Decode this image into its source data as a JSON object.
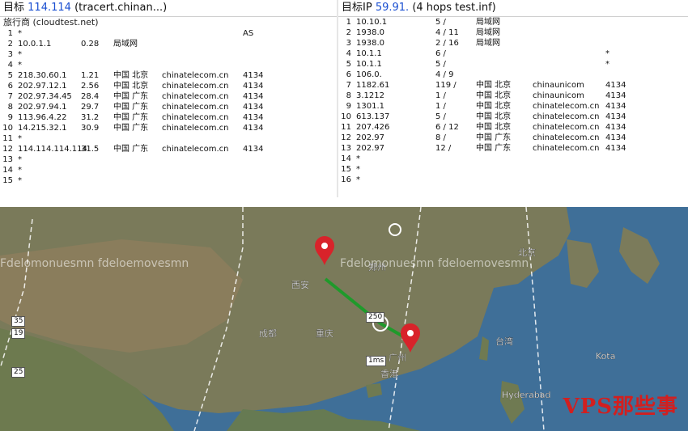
{
  "colors": {
    "accent_blue": "#1a4fd1",
    "pin_red": "#d8232a",
    "route_green": "#1f9a2b",
    "watermark_red": "#d21f1f"
  },
  "left_panel": {
    "title_prefix": "目标",
    "title_highlight": "114.114",
    "title_suffix": "(tracert.chinan...)",
    "subtitle": "旅行商 (cloudtest.net)",
    "hops": [
      {
        "n": "1",
        "ip": "*",
        "ms": "",
        "loc": "",
        "dom": "",
        "as": "AS"
      },
      {
        "n": "2",
        "ip": "10.0.1.1",
        "ms": "0.28",
        "loc": "局域网",
        "dom": "",
        "as": ""
      },
      {
        "n": "3",
        "ip": "*",
        "ms": "",
        "loc": "",
        "dom": "",
        "as": ""
      },
      {
        "n": "4",
        "ip": "*",
        "ms": "",
        "loc": "",
        "dom": "",
        "as": ""
      },
      {
        "n": "5",
        "ip": "218.30.60.1",
        "ms": "1.21",
        "loc": "中国 北京",
        "dom": "chinatelecom.cn",
        "as": "4134"
      },
      {
        "n": "6",
        "ip": "202.97.12.1",
        "ms": "2.56",
        "loc": "中国 北京",
        "dom": "chinatelecom.cn",
        "as": "4134"
      },
      {
        "n": "7",
        "ip": "202.97.34.45",
        "ms": "28.4",
        "loc": "中国 广东",
        "dom": "chinatelecom.cn",
        "as": "4134"
      },
      {
        "n": "8",
        "ip": "202.97.94.1",
        "ms": "29.7",
        "loc": "中国 广东",
        "dom": "chinatelecom.cn",
        "as": "4134"
      },
      {
        "n": "9",
        "ip": "113.96.4.22",
        "ms": "31.2",
        "loc": "中国 广东",
        "dom": "chinatelecom.cn",
        "as": "4134"
      },
      {
        "n": "10",
        "ip": "14.215.32.1",
        "ms": "30.9",
        "loc": "中国 广东",
        "dom": "chinatelecom.cn",
        "as": "4134"
      },
      {
        "n": "11",
        "ip": "*",
        "ms": "",
        "loc": "",
        "dom": "",
        "as": ""
      },
      {
        "n": "12",
        "ip": "114.114.114.114",
        "ms": "31.5",
        "loc": "中国 广东",
        "dom": "chinatelecom.cn",
        "as": "4134"
      },
      {
        "n": "13",
        "ip": "*",
        "ms": "",
        "loc": "",
        "dom": "",
        "as": ""
      },
      {
        "n": "14",
        "ip": "*",
        "ms": "",
        "loc": "",
        "dom": "",
        "as": ""
      },
      {
        "n": "15",
        "ip": "*",
        "ms": "",
        "loc": "",
        "dom": "",
        "as": ""
      }
    ]
  },
  "right_panel": {
    "title_prefix": "目标IP",
    "title_highlight": "59.91.",
    "title_suffix": "(4 hops test.inf)",
    "hops": [
      {
        "n": "1",
        "ip": "10.10.1",
        "ms": "5 /",
        "loc": "局域网",
        "dom": "",
        "as": ""
      },
      {
        "n": "2",
        "ip": "1938.0",
        "ms": "4 / 11",
        "loc": "局域网",
        "dom": "",
        "as": ""
      },
      {
        "n": "3",
        "ip": "1938.0",
        "ms": "2 / 16",
        "loc": "局域网",
        "dom": "",
        "as": ""
      },
      {
        "n": "4",
        "ip": "10.1.1",
        "ms": "6 /",
        "loc": "",
        "dom": "",
        "as": "*"
      },
      {
        "n": "5",
        "ip": "10.1.1",
        "ms": "5 /",
        "loc": "",
        "dom": "",
        "as": "*"
      },
      {
        "n": "6",
        "ip": "106.0.",
        "ms": "4 / 9",
        "loc": "",
        "dom": "",
        "as": ""
      },
      {
        "n": "7",
        "ip": "1182.61",
        "ms": "119 /",
        "loc": "中国 北京",
        "dom": "chinaunicom",
        "as": "4134"
      },
      {
        "n": "8",
        "ip": "3.1212",
        "ms": "1 /",
        "loc": "中国 北京",
        "dom": "chinaunicom",
        "as": "4134"
      },
      {
        "n": "9",
        "ip": "1301.1",
        "ms": "1 /",
        "loc": "中国 北京",
        "dom": "chinatelecom.cn",
        "as": "4134"
      },
      {
        "n": "10",
        "ip": "613.137",
        "ms": "5 /",
        "loc": "中国 北京",
        "dom": "chinatelecom.cn",
        "as": "4134"
      },
      {
        "n": "11",
        "ip": "207.426",
        "ms": "6 / 12",
        "loc": "中国 北京",
        "dom": "chinatelecom.cn",
        "as": "4134"
      },
      {
        "n": "12",
        "ip": "202.97",
        "ms": "8 /",
        "loc": "中国 广东",
        "dom": "chinatelecom.cn",
        "as": "4134"
      },
      {
        "n": "13",
        "ip": "202.97",
        "ms": "12 /",
        "loc": "中国 广东",
        "dom": "chinatelecom.cn",
        "as": "4134"
      },
      {
        "n": "14",
        "ip": "*",
        "ms": "",
        "loc": "",
        "dom": "",
        "as": ""
      },
      {
        "n": "15",
        "ip": "*",
        "ms": "",
        "loc": "",
        "dom": "",
        "as": ""
      },
      {
        "n": "16",
        "ip": "*",
        "ms": "",
        "loc": "",
        "dom": "",
        "as": ""
      }
    ]
  },
  "map": {
    "labels": [
      "北京",
      "郑州",
      "西安",
      "成都",
      "重庆",
      "广州",
      "香港",
      "台湾",
      "Hyderabad",
      "Kota"
    ],
    "pin_labels": [
      {
        "text": "250"
      },
      {
        "text": "1ms"
      },
      {
        "text": "35"
      },
      {
        "text": "19"
      },
      {
        "text": "25"
      }
    ],
    "watermark": "VPS那些事",
    "overlay_text": "Fdelomonuesmn fdeloemovesmn"
  }
}
